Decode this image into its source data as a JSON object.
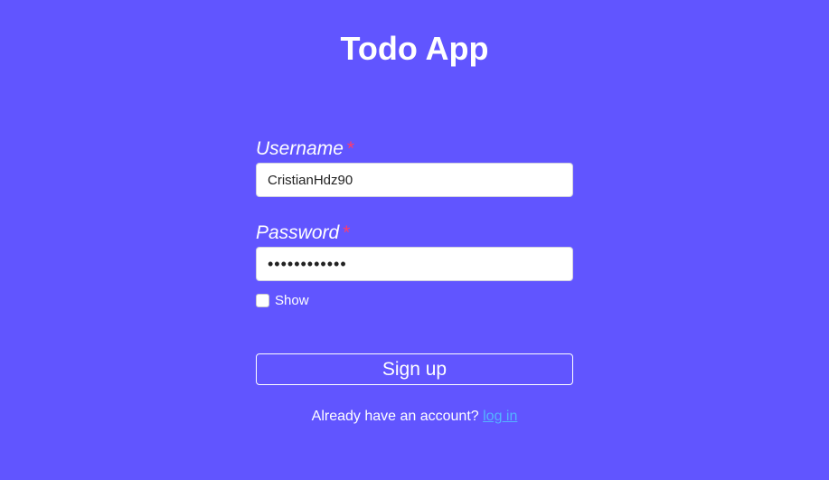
{
  "app": {
    "title": "Todo App"
  },
  "form": {
    "username": {
      "label": "Username",
      "required_marker": "*",
      "value": "CristianHdz90"
    },
    "password": {
      "label": "Password",
      "required_marker": "*",
      "masked_value": "••••••••••••"
    },
    "show_password": {
      "label": "Show",
      "checked": false
    },
    "signup_label": "Sign up",
    "login_prompt": "Already have an account?",
    "login_link": "log in"
  },
  "colors": {
    "background": "#6155ff",
    "required_star": "#ff3b6b",
    "link": "#54b4ff"
  }
}
